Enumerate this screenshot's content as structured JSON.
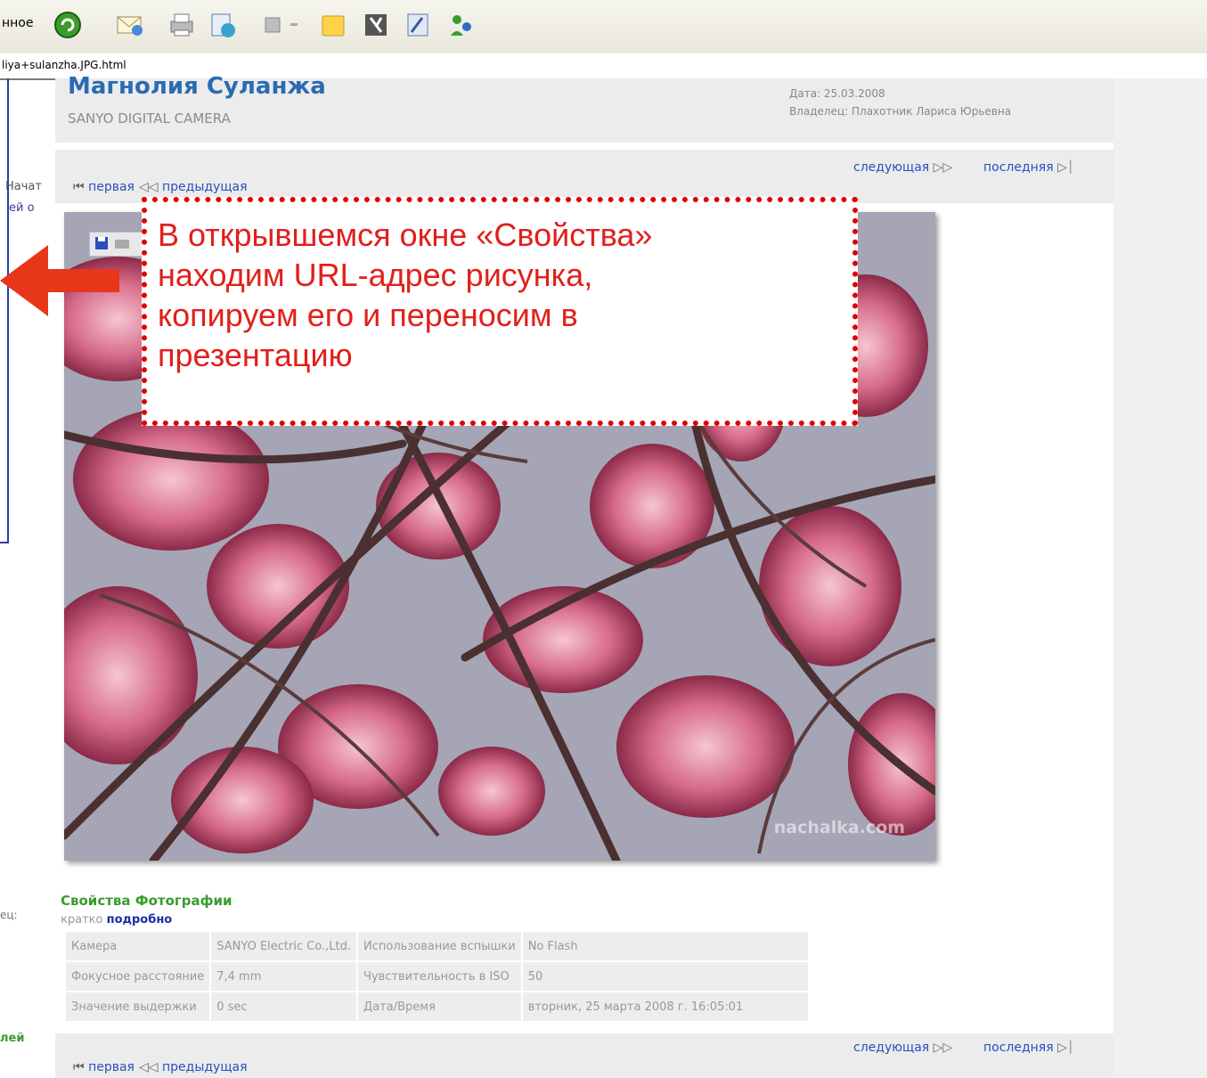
{
  "toolbar": {
    "left_text": "нное",
    "icons": [
      "refresh-icon",
      "mail-icon",
      "print-icon",
      "edit-icon",
      "stop-icon",
      "folder-icon",
      "favorites-icon",
      "tools-icon",
      "users-icon"
    ]
  },
  "address": {
    "url_fragment": "liya+sulanzha.JPG.html"
  },
  "left_panel": {
    "text1": "Начат",
    "text2": "ей о",
    "text3": "ец:",
    "text4": "лей"
  },
  "photo": {
    "title": "Магнолия Суланжа",
    "description": "SANYO DIGITAL CAMERA",
    "date": "Дата: 25.03.2008",
    "owner": "Владелец: Плахотник Лариса Юрьевна",
    "watermark": "nachalka.com"
  },
  "nav": {
    "first": "первая",
    "previous": "предыдущая",
    "next": "следующая",
    "last": "последняя"
  },
  "annotation": {
    "lines": [
      "В открывшемся окне «Свойства»",
      "находим URL-адрес рисунка,",
      "копируем его и переносим в",
      "презентацию"
    ]
  },
  "properties": {
    "title": "Свойства Фотографии",
    "brief": "кратко",
    "detail": "подробно",
    "rows": [
      [
        "Камера",
        "SANYO Electric Co.,Ltd.",
        "Использование вспышки",
        "No Flash"
      ],
      [
        "Фокусное расстояние",
        "7,4 mm",
        "Чувствительность в ISO",
        "50"
      ],
      [
        "Значение выдержки",
        "0 sec",
        "Дата/Время",
        "вторник, 25 марта 2008 г. 16:05:01"
      ]
    ]
  },
  "colors": {
    "accent_red": "#e0201a",
    "link_blue": "#2a4ec0",
    "title_blue": "#2b6bb3",
    "props_green": "#3a9b2e"
  }
}
